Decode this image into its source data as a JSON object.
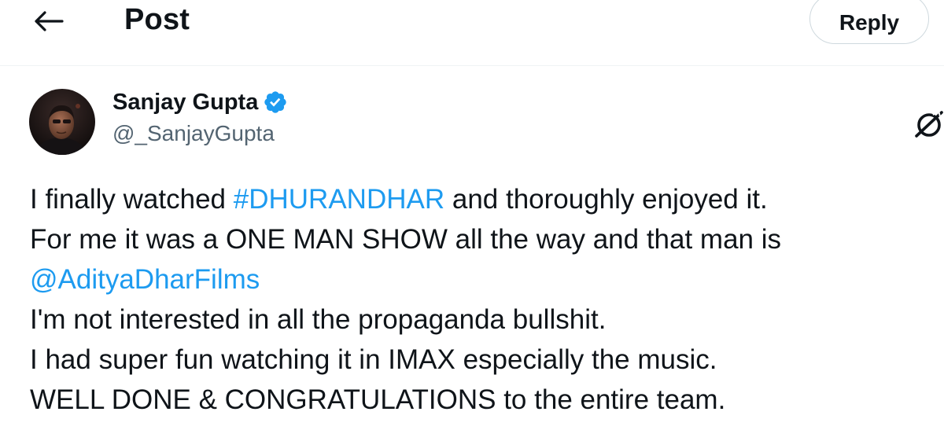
{
  "header": {
    "back_icon": "arrow-left-icon",
    "title": "Post",
    "reply_label": "Reply"
  },
  "author": {
    "display_name": "Sanjay Gupta",
    "handle": "@_SanjayGupta",
    "verified_icon": "verified-badge-icon",
    "verified_color": "#1d9bf0",
    "avatar_icon": "avatar"
  },
  "actions": {
    "grok_icon": "grok-icon"
  },
  "tweet": {
    "line1_prefix": "I finally watched ",
    "line1_hashtag": "#DHURANDHAR",
    "line1_suffix": " and thoroughly enjoyed it.",
    "line2": "For me it was a ONE MAN SHOW all the way and that man is",
    "line3_mention": "@AdityaDharFilms",
    "line4": "I'm not interested in all the propaganda bullshit.",
    "line5": "I had super fun watching it in IMAX especially the music.",
    "line6": "WELL DONE & CONGRATULATIONS to the entire team."
  },
  "colors": {
    "link": "#1d9bf0",
    "text": "#0f1419",
    "secondary_text": "#536471",
    "border": "#cfd9de"
  }
}
